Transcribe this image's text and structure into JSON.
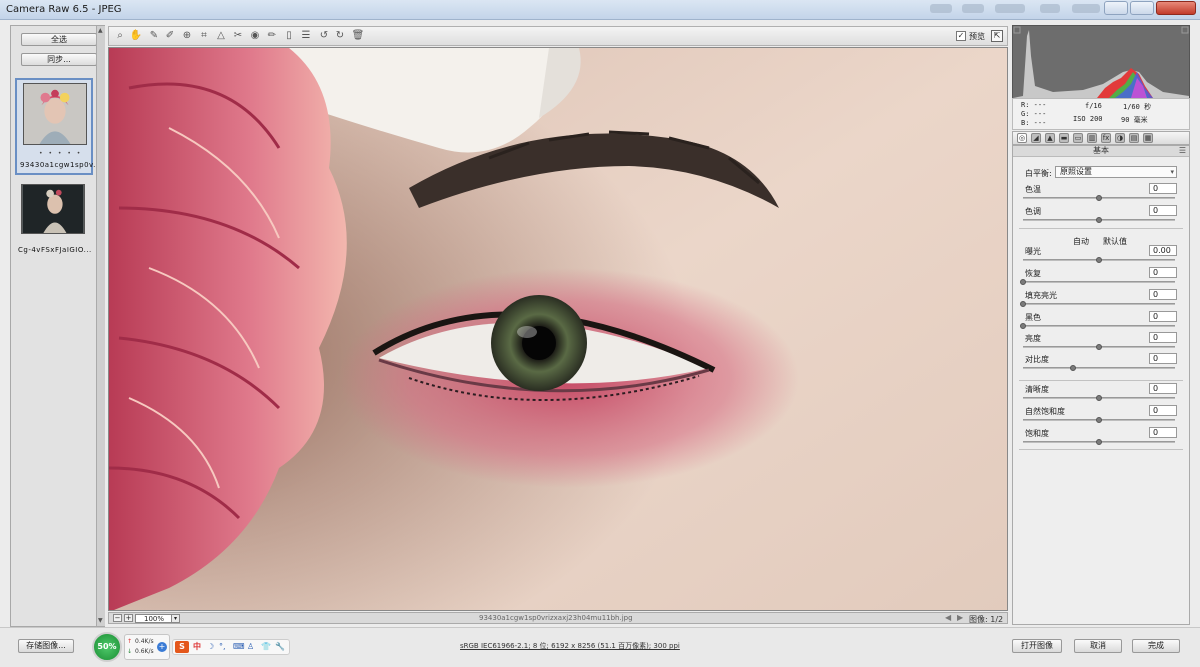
{
  "window": {
    "title": "Camera Raw 6.5 -  JPEG"
  },
  "filmstrip": {
    "select_all_label": "全选",
    "sync_label": "同步...",
    "images": [
      {
        "name": "93430a1cgw1sp0v...",
        "rating": "• • • • •",
        "selected": true
      },
      {
        "name": "Cg-4vFSxFJaIGIO...",
        "selected": false
      }
    ]
  },
  "toolbar": {
    "tools": [
      "zoom-icon",
      "hand-icon",
      "white-balance-icon",
      "color-sampler-icon",
      "target-adjust-icon",
      "crop-icon",
      "straighten-icon",
      "spot-removal-icon",
      "red-eye-icon",
      "adjustment-brush-icon",
      "graduated-filter-icon",
      "preferences-icon",
      "rotate-left-icon",
      "rotate-right-icon",
      "trash-icon"
    ],
    "preview_label": "预览",
    "preview_checked": true
  },
  "statusbar": {
    "zoom_value": "100%",
    "filename": "93430a1cgw1sp0vrizxaxj23h04mu11bh.jpg",
    "page_label": "图像: 1/2"
  },
  "readout": {
    "r": "R:  ---",
    "g": "G:  ---",
    "b": "B:  ---",
    "aperture": "f/16",
    "shutter": "1/60 秒",
    "iso": "ISO 200",
    "focal": "90 毫米"
  },
  "panel": {
    "title": "基本",
    "white_balance_label": "白平衡:",
    "white_balance_value": "原照设置",
    "auto_label": "自动",
    "default_label": "默认值",
    "sliders": [
      {
        "label": "色温",
        "value": "0",
        "level": 0.5
      },
      {
        "label": "色调",
        "value": "0",
        "level": 0.5
      },
      {
        "label": "曝光",
        "value": "0.00",
        "level": 0.5
      },
      {
        "label": "恢复",
        "value": "0",
        "level": 0.0
      },
      {
        "label": "填充亮光",
        "value": "0",
        "level": 0.0
      },
      {
        "label": "黑色",
        "value": "0",
        "level": 0.0
      },
      {
        "label": "亮度",
        "value": "0",
        "level": 0.5
      },
      {
        "label": "对比度",
        "value": "0",
        "level": 0.33
      },
      {
        "label": "清晰度",
        "value": "0",
        "level": 0.5
      },
      {
        "label": "自然饱和度",
        "value": "0",
        "level": 0.5
      },
      {
        "label": "饱和度",
        "value": "0",
        "level": 0.5
      }
    ]
  },
  "bottombar": {
    "save_label": "存储图像...",
    "info_link": "sRGB IEC61966-2.1; 8 位; 6192 x 8256 (51.1 百万像素); 300 ppi",
    "open_label": "打开图像",
    "cancel_label": "取消",
    "done_label": "完成"
  },
  "taskbar": {
    "gauge_value": "50%",
    "upload_speed": "0.4K/s",
    "download_speed": "0.6K/s",
    "ime_mode": "中"
  }
}
